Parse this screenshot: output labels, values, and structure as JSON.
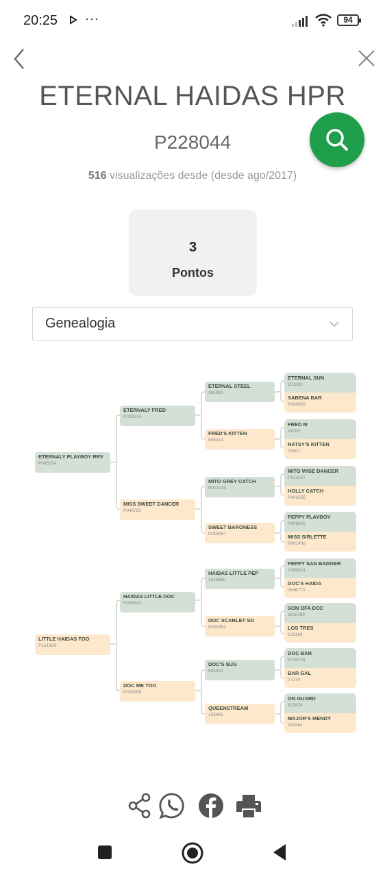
{
  "status_bar": {
    "time": "20:25",
    "dots": "···",
    "battery": "94"
  },
  "header": {
    "horse_name": "ETERNAL HAIDAS HPR",
    "registration": "P228044",
    "views_count": "516",
    "views_text": "visualizações desde",
    "views_since": "(desde ago/2017)"
  },
  "points": {
    "value": "3",
    "label": "Pontos"
  },
  "select": {
    "value": "Genealogia"
  },
  "pedigree": {
    "gen1": [
      {
        "name": "ETERNALY PLAYBOY RRV",
        "reg": "P085154"
      },
      {
        "name": "LITTLE HAIDAS TOO",
        "reg": "P151358"
      }
    ],
    "gen2": [
      {
        "name": "ETERNALY FRED",
        "reg": "P00217A"
      },
      {
        "name": "MISS SWEET DANCER",
        "reg": "P046750"
      },
      {
        "name": "HAIDAS LITTLE DOC",
        "reg": "P038640"
      },
      {
        "name": "DOC ME TOO",
        "reg": "P030558"
      }
    ],
    "gen3": [
      {
        "name": "ETERNAL STEEL",
        "reg": "385392"
      },
      {
        "name": "FRED'S KITTEN",
        "reg": "806314"
      },
      {
        "name": "MITO GREY CATCH",
        "reg": "P017033"
      },
      {
        "name": "SWEET BARONESS",
        "reg": "P018067"
      },
      {
        "name": "HAIDAS LITTLE PEP",
        "reg": "1643660"
      },
      {
        "name": "DOC SCARLET SO",
        "reg": "P028452"
      },
      {
        "name": "DOC'S SUG",
        "reg": "685453"
      },
      {
        "name": "QUEENSTREAM",
        "reg": "125485"
      }
    ],
    "gen4": [
      {
        "name": "ETERNAL SUN",
        "reg": "151802"
      },
      {
        "name": "SABENA BAR",
        "reg": "P000659"
      },
      {
        "name": "FRED M",
        "reg": "34000"
      },
      {
        "name": "RATSY'S KITTEN",
        "reg": "23407"
      },
      {
        "name": "MITO WISE DANCER",
        "reg": "P013227"
      },
      {
        "name": "HOLLY CATCH",
        "reg": "P003556"
      },
      {
        "name": "PEPPY PLAYBOY",
        "reg": "P009826"
      },
      {
        "name": "MISS SIRLETTE",
        "reg": "P001408"
      },
      {
        "name": "PEPPY SAN BADGER",
        "reg": "1089924"
      },
      {
        "name": "DOC'S HAIDA",
        "reg": "0646770"
      },
      {
        "name": "SON OFA DOC",
        "reg": "1156780"
      },
      {
        "name": "LOS TRES",
        "reg": "133164"
      },
      {
        "name": "DOC BAR",
        "reg": "0076738"
      },
      {
        "name": "BAR GAL",
        "reg": "77270"
      },
      {
        "name": "ON GUARD",
        "reg": "322674"
      },
      {
        "name": "MAJOR'S MENDY",
        "reg": "343464"
      }
    ]
  },
  "colors": {
    "sire": "#d4dfd6",
    "dam": "#fde8cc",
    "accent": "#1f9e4b"
  },
  "icons": {
    "share": "share-icon",
    "whatsapp": "whatsapp-icon",
    "facebook": "facebook-icon",
    "print": "print-icon"
  }
}
